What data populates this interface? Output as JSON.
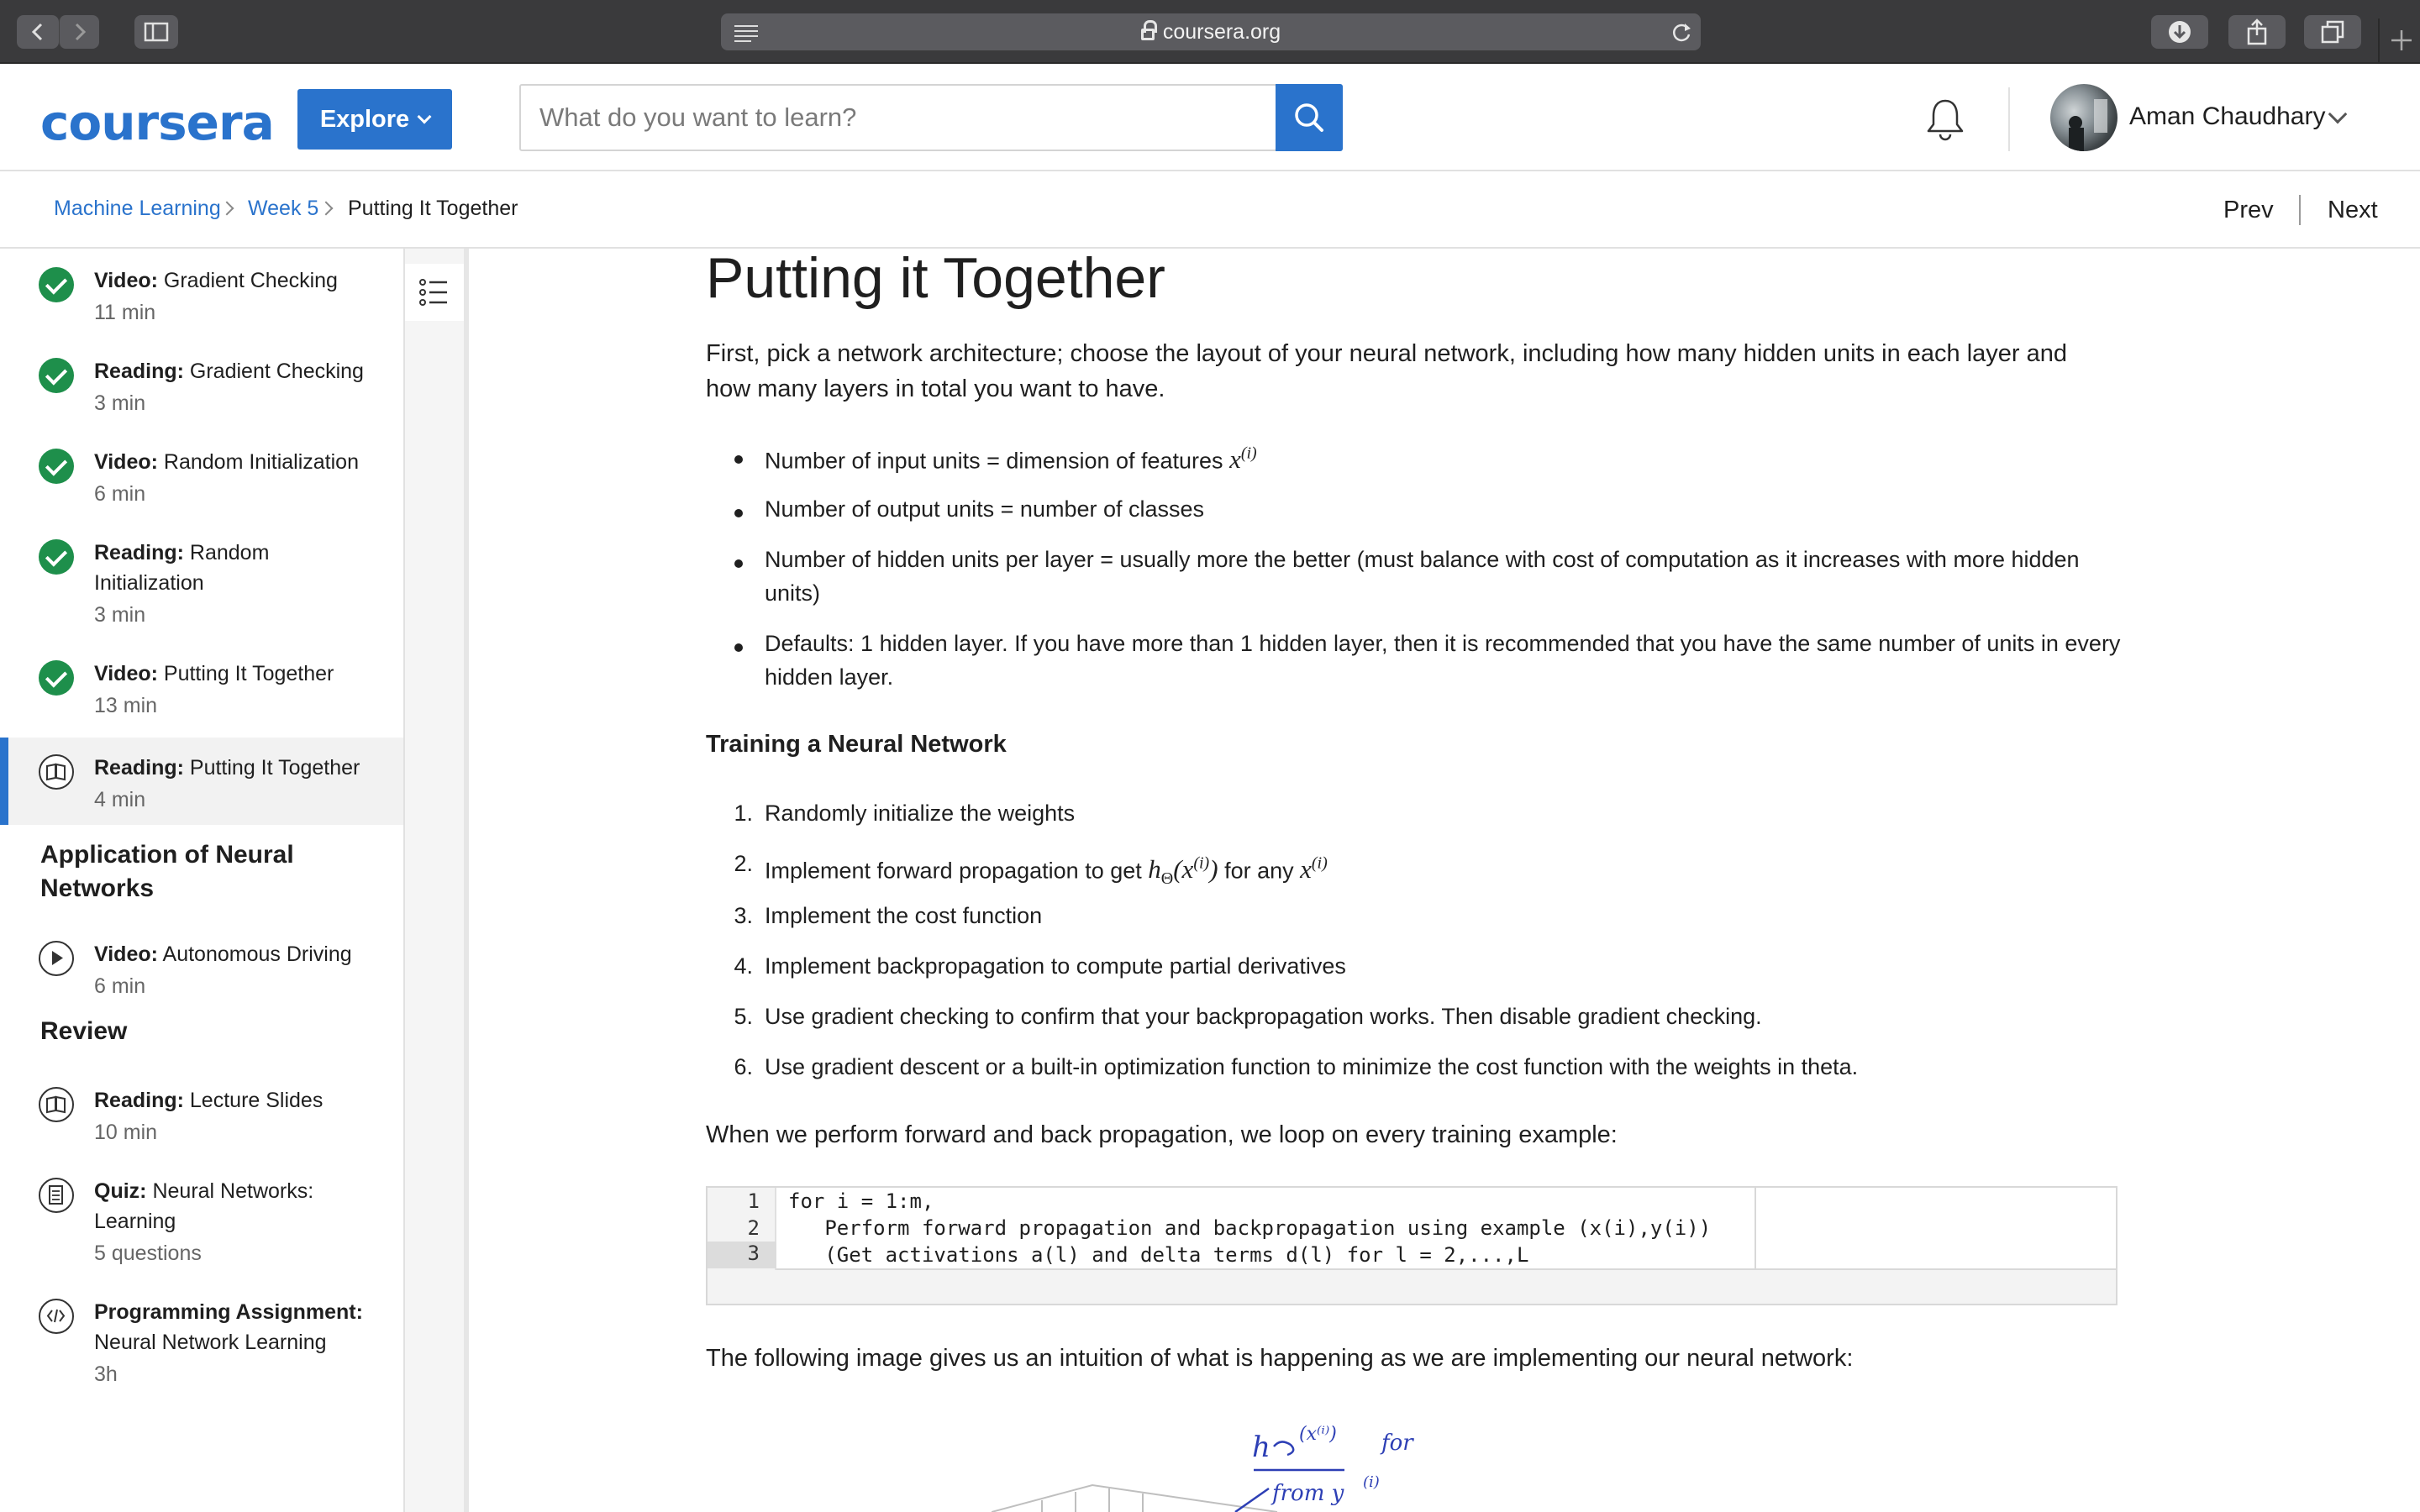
{
  "browser": {
    "url": "coursera.org"
  },
  "header": {
    "logo": "coursera",
    "explore_label": "Explore",
    "search_placeholder": "What do you want to learn?",
    "user_name": "Aman Chaudhary"
  },
  "breadcrumb": {
    "items": [
      "Machine Learning",
      "Week 5",
      "Putting It Together"
    ],
    "prev": "Prev",
    "next": "Next"
  },
  "sidebar": {
    "items": [
      {
        "kind": "Video:",
        "title": "Gradient Checking",
        "duration": "11 min",
        "status": "done"
      },
      {
        "kind": "Reading:",
        "title": "Gradient Checking",
        "duration": "3 min",
        "status": "done"
      },
      {
        "kind": "Video:",
        "title": "Random Initialization",
        "duration": "6 min",
        "status": "done"
      },
      {
        "kind": "Reading:",
        "title": "Random Initialization",
        "duration": "3 min",
        "status": "done"
      },
      {
        "kind": "Video:",
        "title": "Putting It Together",
        "duration": "13 min",
        "status": "done"
      },
      {
        "kind": "Reading:",
        "title": "Putting It Together",
        "duration": "4 min",
        "status": "active"
      }
    ],
    "section_app": "Application of Neural Networks",
    "app_items": [
      {
        "kind": "Video:",
        "title": "Autonomous Driving",
        "duration": "6 min"
      }
    ],
    "section_review": "Review",
    "review_items": [
      {
        "kind": "Reading:",
        "title": "Lecture Slides",
        "duration": "10 min"
      },
      {
        "kind": "Quiz:",
        "title": "Neural Networks: Learning",
        "duration": "5 questions"
      },
      {
        "kind": "Programming Assignment:",
        "title": "Neural Network Learning",
        "duration": "3h"
      }
    ]
  },
  "content": {
    "title": "Putting it Together",
    "intro": "First, pick a network architecture; choose the layout of your neural network, including how many hidden units in each layer and how many layers in total you want to have.",
    "bullets": [
      "Number of input units = dimension of features",
      "Number of output units = number of classes",
      "Number of hidden units per layer = usually more the better (must balance with cost of computation as it increases with more hidden units)",
      "Defaults: 1 hidden layer. If you have more than 1 hidden layer, then it is recommended that you have the same number of units in every hidden layer."
    ],
    "bullet1_math": "x",
    "bullet1_sup": "(i)",
    "training_heading": "Training a Neural Network",
    "steps": [
      "Randomly initialize the weights",
      "Implement forward propagation to get",
      "Implement the cost function",
      "Implement backpropagation to compute partial derivatives",
      "Use gradient checking to confirm that your backpropagation works. Then disable gradient checking.",
      "Use gradient descent or a built-in optimization function to minimize the cost function with the weights in theta."
    ],
    "step_nums": [
      "1.",
      "2.",
      "3.",
      "4.",
      "5.",
      "6."
    ],
    "step2_math_h": "h",
    "step2_math_sub": "Θ",
    "step2_math_arg": "(x",
    "step2_math_sup": "(i)",
    "step2_math_close": ")",
    "step2_for_any": "for any",
    "step2_math_x": "x",
    "loop_text": "When we perform forward and back propagation, we loop on every training example:",
    "code_lines": [
      "for i = 1:m,",
      "   Perform forward propagation and backpropagation using example (x(i),y(i))",
      "   (Get activations a(l) and delta terms d(l) for l = 2,...,L"
    ],
    "code_line_numbers": [
      "1",
      "2",
      "3"
    ],
    "image_text": "The following image gives us an intuition of what is happening as we are implementing our neural network:",
    "sketch_text_1": "h",
    "sketch_text_2": "from y"
  },
  "colors": {
    "brand": "#2a73cc",
    "complete": "#1e8f4b"
  }
}
